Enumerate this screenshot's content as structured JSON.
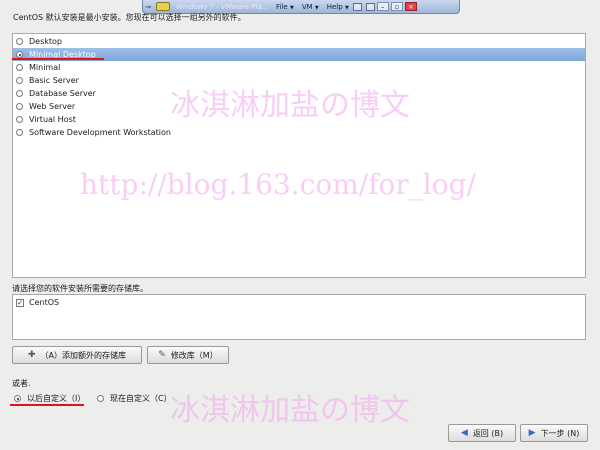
{
  "vm_toolbar": {
    "window_title": "Windows 7 - VMware Pla...",
    "menus": [
      "File",
      "VM",
      "Help"
    ]
  },
  "instruction": "CentOS 默认安装是最小安装。您现在可以选择一组另外的软件。",
  "install_options": [
    {
      "label": "Desktop",
      "selected": false
    },
    {
      "label": "Minimal Desktop",
      "selected": true
    },
    {
      "label": "Minimal",
      "selected": false
    },
    {
      "label": "Basic Server",
      "selected": false
    },
    {
      "label": "Database Server",
      "selected": false
    },
    {
      "label": "Web Server",
      "selected": false
    },
    {
      "label": "Virtual Host",
      "selected": false
    },
    {
      "label": "Software Development Workstation",
      "selected": false
    }
  ],
  "repo_label": "请选择您的软件安装所需要的存储库。",
  "repositories": [
    {
      "label": "CentOS",
      "checked": true
    }
  ],
  "buttons": {
    "add_repo": "（A）添加额外的存储库",
    "modify_repo": "修改库（M）",
    "back": "返回 (B)",
    "next": "下一步 (N)"
  },
  "or_label": "或者.",
  "customize": {
    "later": "以后自定义（I）",
    "now": "现在自定义（C）"
  },
  "watermark": {
    "name": "冰淇淋加盐の博文",
    "url": "http://blog.163.com/for_log/"
  },
  "colors": {
    "selection": "#7ea6d6",
    "annotation_red": "#e0141b",
    "watermark": "#f3a6f0"
  }
}
